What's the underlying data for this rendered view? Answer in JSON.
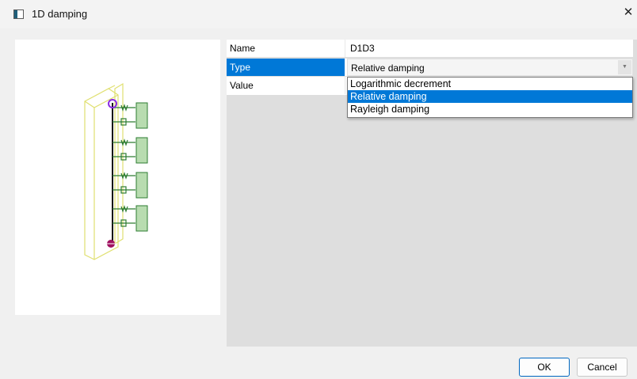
{
  "window": {
    "title": "1D damping",
    "close_glyph": "✕"
  },
  "properties": {
    "name": {
      "label": "Name",
      "value": "D1D3"
    },
    "type": {
      "label": "Type",
      "value": "Relative damping"
    },
    "value": {
      "label": "Value"
    }
  },
  "dropdown": {
    "options": [
      {
        "label": "Logarithmic decrement",
        "selected": false
      },
      {
        "label": "Relative damping",
        "selected": true
      },
      {
        "label": "Rayleigh damping",
        "selected": false
      }
    ]
  },
  "buttons": {
    "ok": "OK",
    "cancel": "Cancel"
  },
  "colors": {
    "selection": "#0078d7",
    "frame": "#e0e070",
    "springs": "#2e7d32",
    "anchor": "#a01060",
    "hinge": "#8a2be2"
  },
  "icons": {
    "app": "dialog-app-icon",
    "close": "close-icon",
    "combo": "chevron-down-icon"
  }
}
